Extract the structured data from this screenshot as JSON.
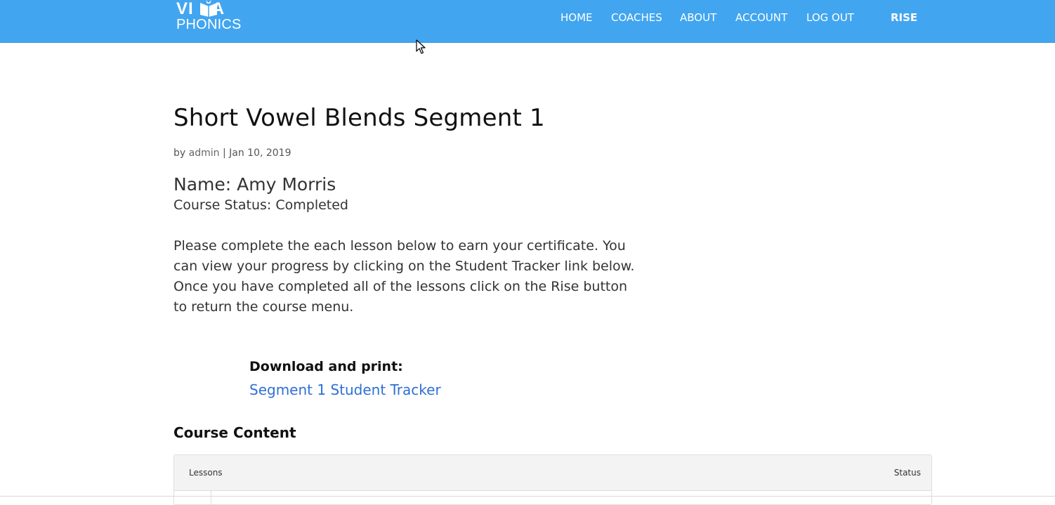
{
  "header": {
    "logo": {
      "top_left": "VI",
      "top_right": "A",
      "bottom": "PHONICS"
    },
    "nav": [
      {
        "label": "HOME"
      },
      {
        "label": "COACHES"
      },
      {
        "label": "ABOUT"
      },
      {
        "label": "ACCOUNT"
      },
      {
        "label": "LOG OUT"
      },
      {
        "label": "RISE"
      }
    ],
    "background_color": "#42a5f0"
  },
  "post": {
    "title": "Short Vowel Blends Segment 1",
    "meta": {
      "by": "by",
      "author": "admin",
      "separator": "|",
      "date": "Jan 10, 2019"
    },
    "name_line": "Name: Amy Morris",
    "status_line": "Course Status: Completed",
    "instructions": "Please complete the each lesson below to earn your certificate. You can view your progress by clicking on the Student Tracker link below. Once you have completed all of the lessons click on the Rise button to return the course menu.",
    "download_label": "Download and print:",
    "tracker_link": "Segment 1 Student Tracker",
    "link_color": "#2f6fd6"
  },
  "course_content": {
    "heading": "Course Content",
    "table": {
      "columns": [
        "Lessons",
        "Status"
      ]
    }
  }
}
